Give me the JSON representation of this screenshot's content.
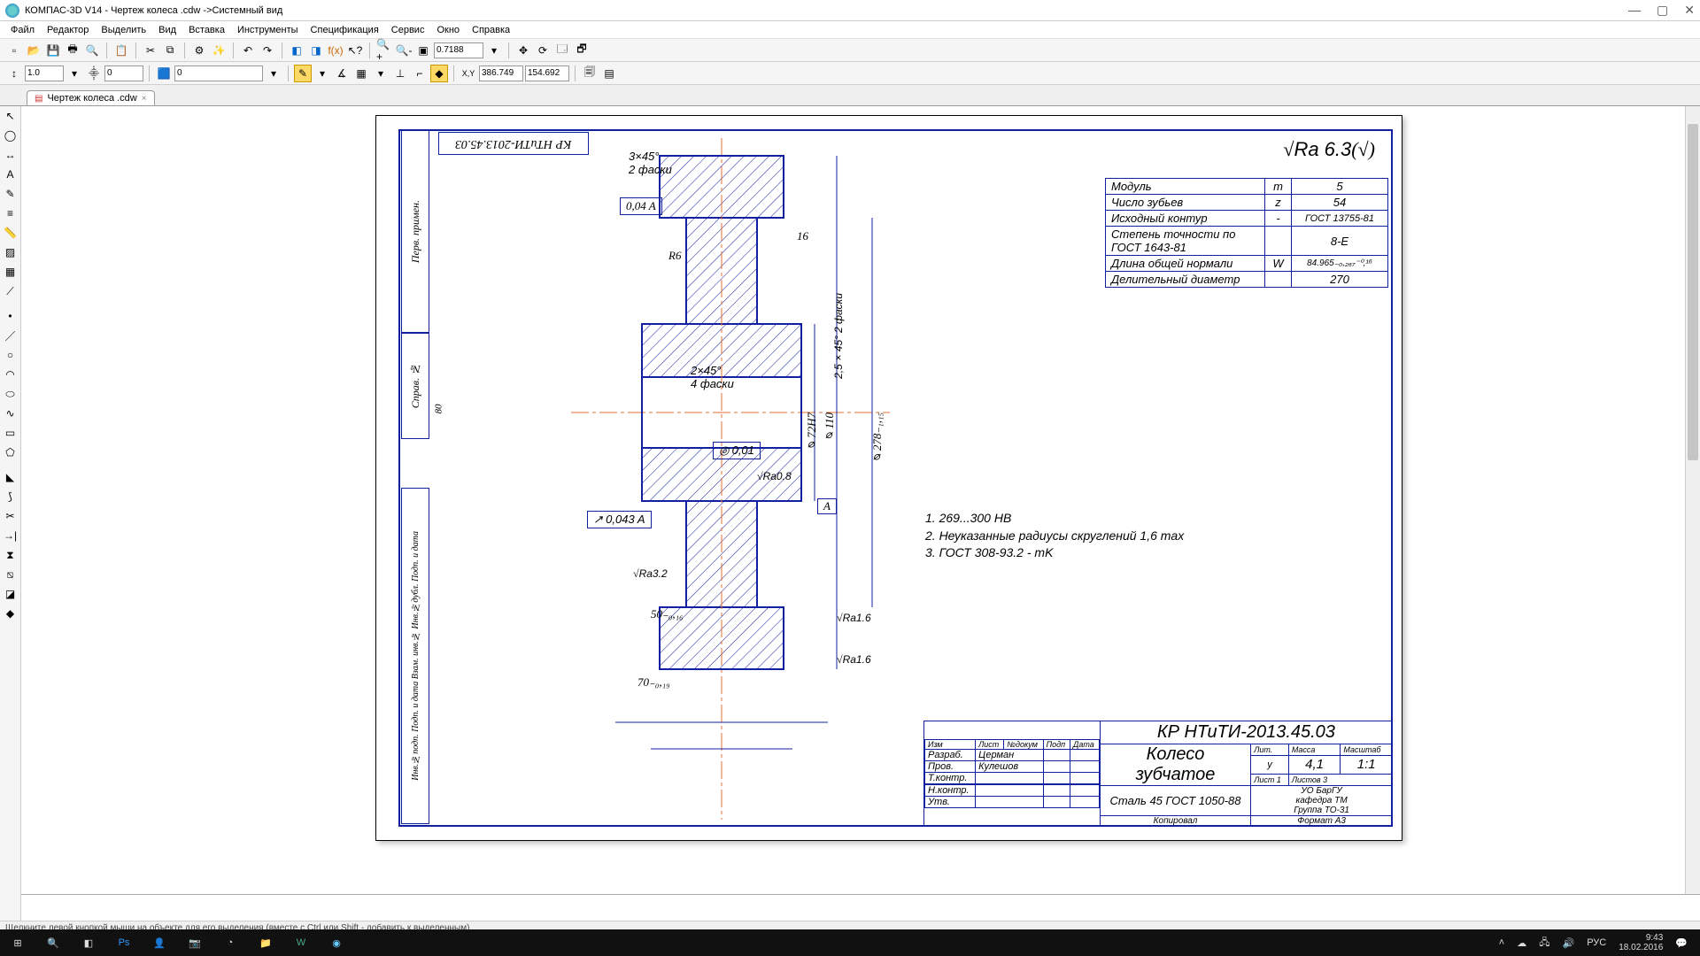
{
  "titlebar": {
    "title": "КОМПАС-3D V14 - Чертеж колеса .cdw ->Системный вид"
  },
  "menu": [
    "Файл",
    "Редактор",
    "Выделить",
    "Вид",
    "Вставка",
    "Инструменты",
    "Спецификация",
    "Сервис",
    "Окно",
    "Справка"
  ],
  "toolbar1": {
    "zoom": "0.7188"
  },
  "toolbar2": {
    "f1": "1.0",
    "f2": "0",
    "f3": "0",
    "coordX": "386.749",
    "coordY": "154.692"
  },
  "tab": {
    "label": "Чертеж колеса .cdw"
  },
  "drawing": {
    "code_rev": "КР НТиТИ-2013.45.03",
    "surface_big": "Ra 6.3",
    "dim_3x45": "3×45°",
    "dim_2faski": "2 фаски",
    "geom1": "0,04  A",
    "dim_R6": "R6",
    "dim_16": "16",
    "dim_25x45": "2,5×45°",
    "dim_2faski_b": "2 фаски",
    "side_label": "Справ. №",
    "pp_label": "Перв. примен.",
    "dim_2x45": "2×45°",
    "dim_4faski": "4 фаски",
    "dim_72H7": "⌀72H7",
    "dim_110": "⌀110",
    "dim_278": "⌀278₋₁,₁₅",
    "geom2": "0,01",
    "ra08": "Ra0.8",
    "A_datum": "А",
    "geom3": "0,043  A",
    "ra32": "Ra3.2",
    "dim_50": "50₋₀,₁₆",
    "dim_70": "70₋₀,₁₉",
    "ra16a": "Ra1.6",
    "ra16b": "Ra1.6",
    "side2": "Инв.№подп.  Подп. и дата  Взам. инв.№  Инв.№дубл.  Подп. и дата",
    "notes": [
      "1.  269...300 HB",
      "2.  Неуказанные радиусы скруглений 1,6 max",
      "3.  ГОСТ 308-93.2 - mK"
    ],
    "num_80": "80"
  },
  "paramtable": {
    "r1": [
      "Модуль",
      "m",
      "5"
    ],
    "r2": [
      "Число зубьев",
      "z",
      "54"
    ],
    "r3": [
      "Исходный контур",
      "-",
      "ГОСТ 13755-81"
    ],
    "r4": [
      "Степень точности по ГОСТ 1643-81",
      "",
      "8-E"
    ],
    "r5": [
      "Длина общей нормали",
      "W",
      "84.965₋₀,₂₆₇⁻⁰,¹⁶"
    ],
    "r6": [
      "Делительный диаметр",
      "",
      "270"
    ]
  },
  "titleblock": {
    "code": "КР НТиТИ-2013.45.03",
    "partname1": "Колесо",
    "partname2": "зубчатое",
    "material": "Сталь 45 ГОСТ 1050-88",
    "mass": "4,1",
    "scale": "1:1",
    "lit": "у",
    "sheets": "Листов 3",
    "sheet": "Лист 1",
    "org1": "УО БарГУ",
    "org2": "кафедра ТМ",
    "org3": "Группа ТО-31",
    "format": "Формат А3",
    "kopiroval": "Копировал",
    "left_rows": [
      "Изм",
      "Лист",
      "№докум",
      "Подп",
      "Дата"
    ],
    "roles": [
      "Разраб.",
      "Пров.",
      "Т.контр.",
      "",
      "Н.контр.",
      "Утв."
    ],
    "names": [
      "Церман",
      "Кулешов",
      "",
      "",
      "",
      ""
    ]
  },
  "statusbar": "Щелкните левой кнопкой мыши на объекте для его выделения (вместе с Ctrl или Shift - добавить к выделенным)",
  "taskbar": {
    "lang": "РУС",
    "time": "9:43",
    "date": "18.02.2016"
  }
}
